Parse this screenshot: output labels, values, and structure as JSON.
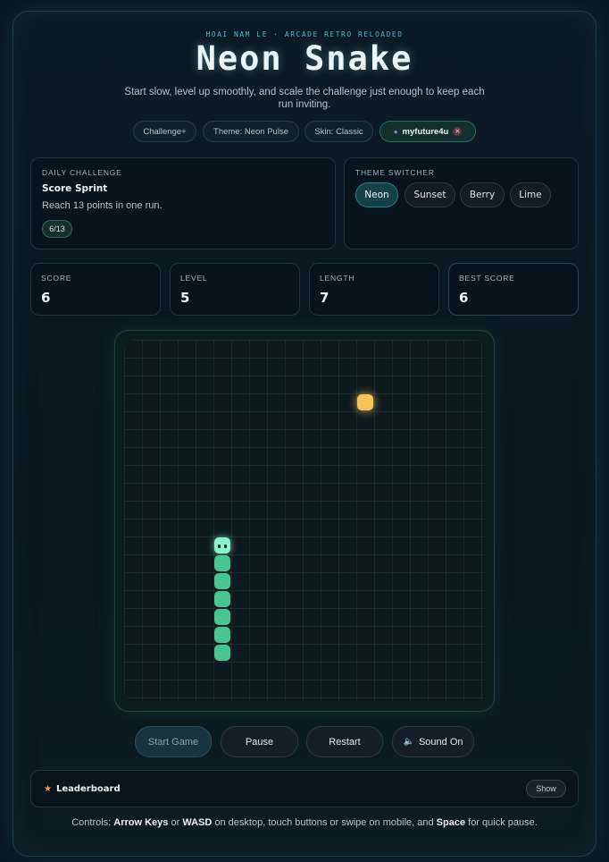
{
  "header": {
    "eyebrow": "HOAI NAM LE · ARCADE RETRO RELOADED",
    "title": "Neon Snake",
    "subtitle": "Start slow, level up smoothly, and scale the challenge just enough to keep each run inviting."
  },
  "chips": {
    "mode": "Challenge+",
    "theme": "Theme: Neon Pulse",
    "skin": "Skin: Classic",
    "user": "myfuture4u",
    "user_icon": "user-icon",
    "remove_icon": "close-icon"
  },
  "daily_challenge": {
    "label": "DAILY CHALLENGE",
    "title": "Score Sprint",
    "description": "Reach 13 points in one run.",
    "progress": "6/13",
    "progress_value": 6,
    "progress_target": 13
  },
  "theme_switcher": {
    "label": "THEME SWITCHER",
    "options": [
      "Neon",
      "Sunset",
      "Berry",
      "Lime"
    ],
    "selected": "Neon"
  },
  "stats": [
    {
      "label": "SCORE",
      "value": "6"
    },
    {
      "label": "LEVEL",
      "value": "5"
    },
    {
      "label": "LENGTH",
      "value": "7"
    },
    {
      "label": "BEST SCORE",
      "value": "6"
    }
  ],
  "board": {
    "columns": 20,
    "rows": 20,
    "snake": [
      [
        5,
        17
      ],
      [
        5,
        16
      ],
      [
        5,
        15
      ],
      [
        5,
        14
      ],
      [
        5,
        13
      ],
      [
        5,
        12
      ],
      [
        5,
        11
      ]
    ],
    "food": [
      13,
      3
    ],
    "colors": {
      "snake": "#48c590",
      "head": "#8ff0cc",
      "food": "#f7c45a"
    }
  },
  "controls": {
    "start": "Start Game",
    "pause": "Pause",
    "restart": "Restart",
    "sound": "Sound On",
    "sound_icon": "speaker-icon"
  },
  "leaderboard": {
    "title": "Leaderboard",
    "icon": "trophy-icon",
    "show_label": "Show"
  },
  "help": {
    "prefix": "Controls: ",
    "keys1": "Arrow Keys",
    "or": " or ",
    "keys2": "WASD",
    "mid": " on desktop, touch buttons or swipe on mobile, and ",
    "keys3": "Space",
    "suffix": " for quick pause."
  }
}
